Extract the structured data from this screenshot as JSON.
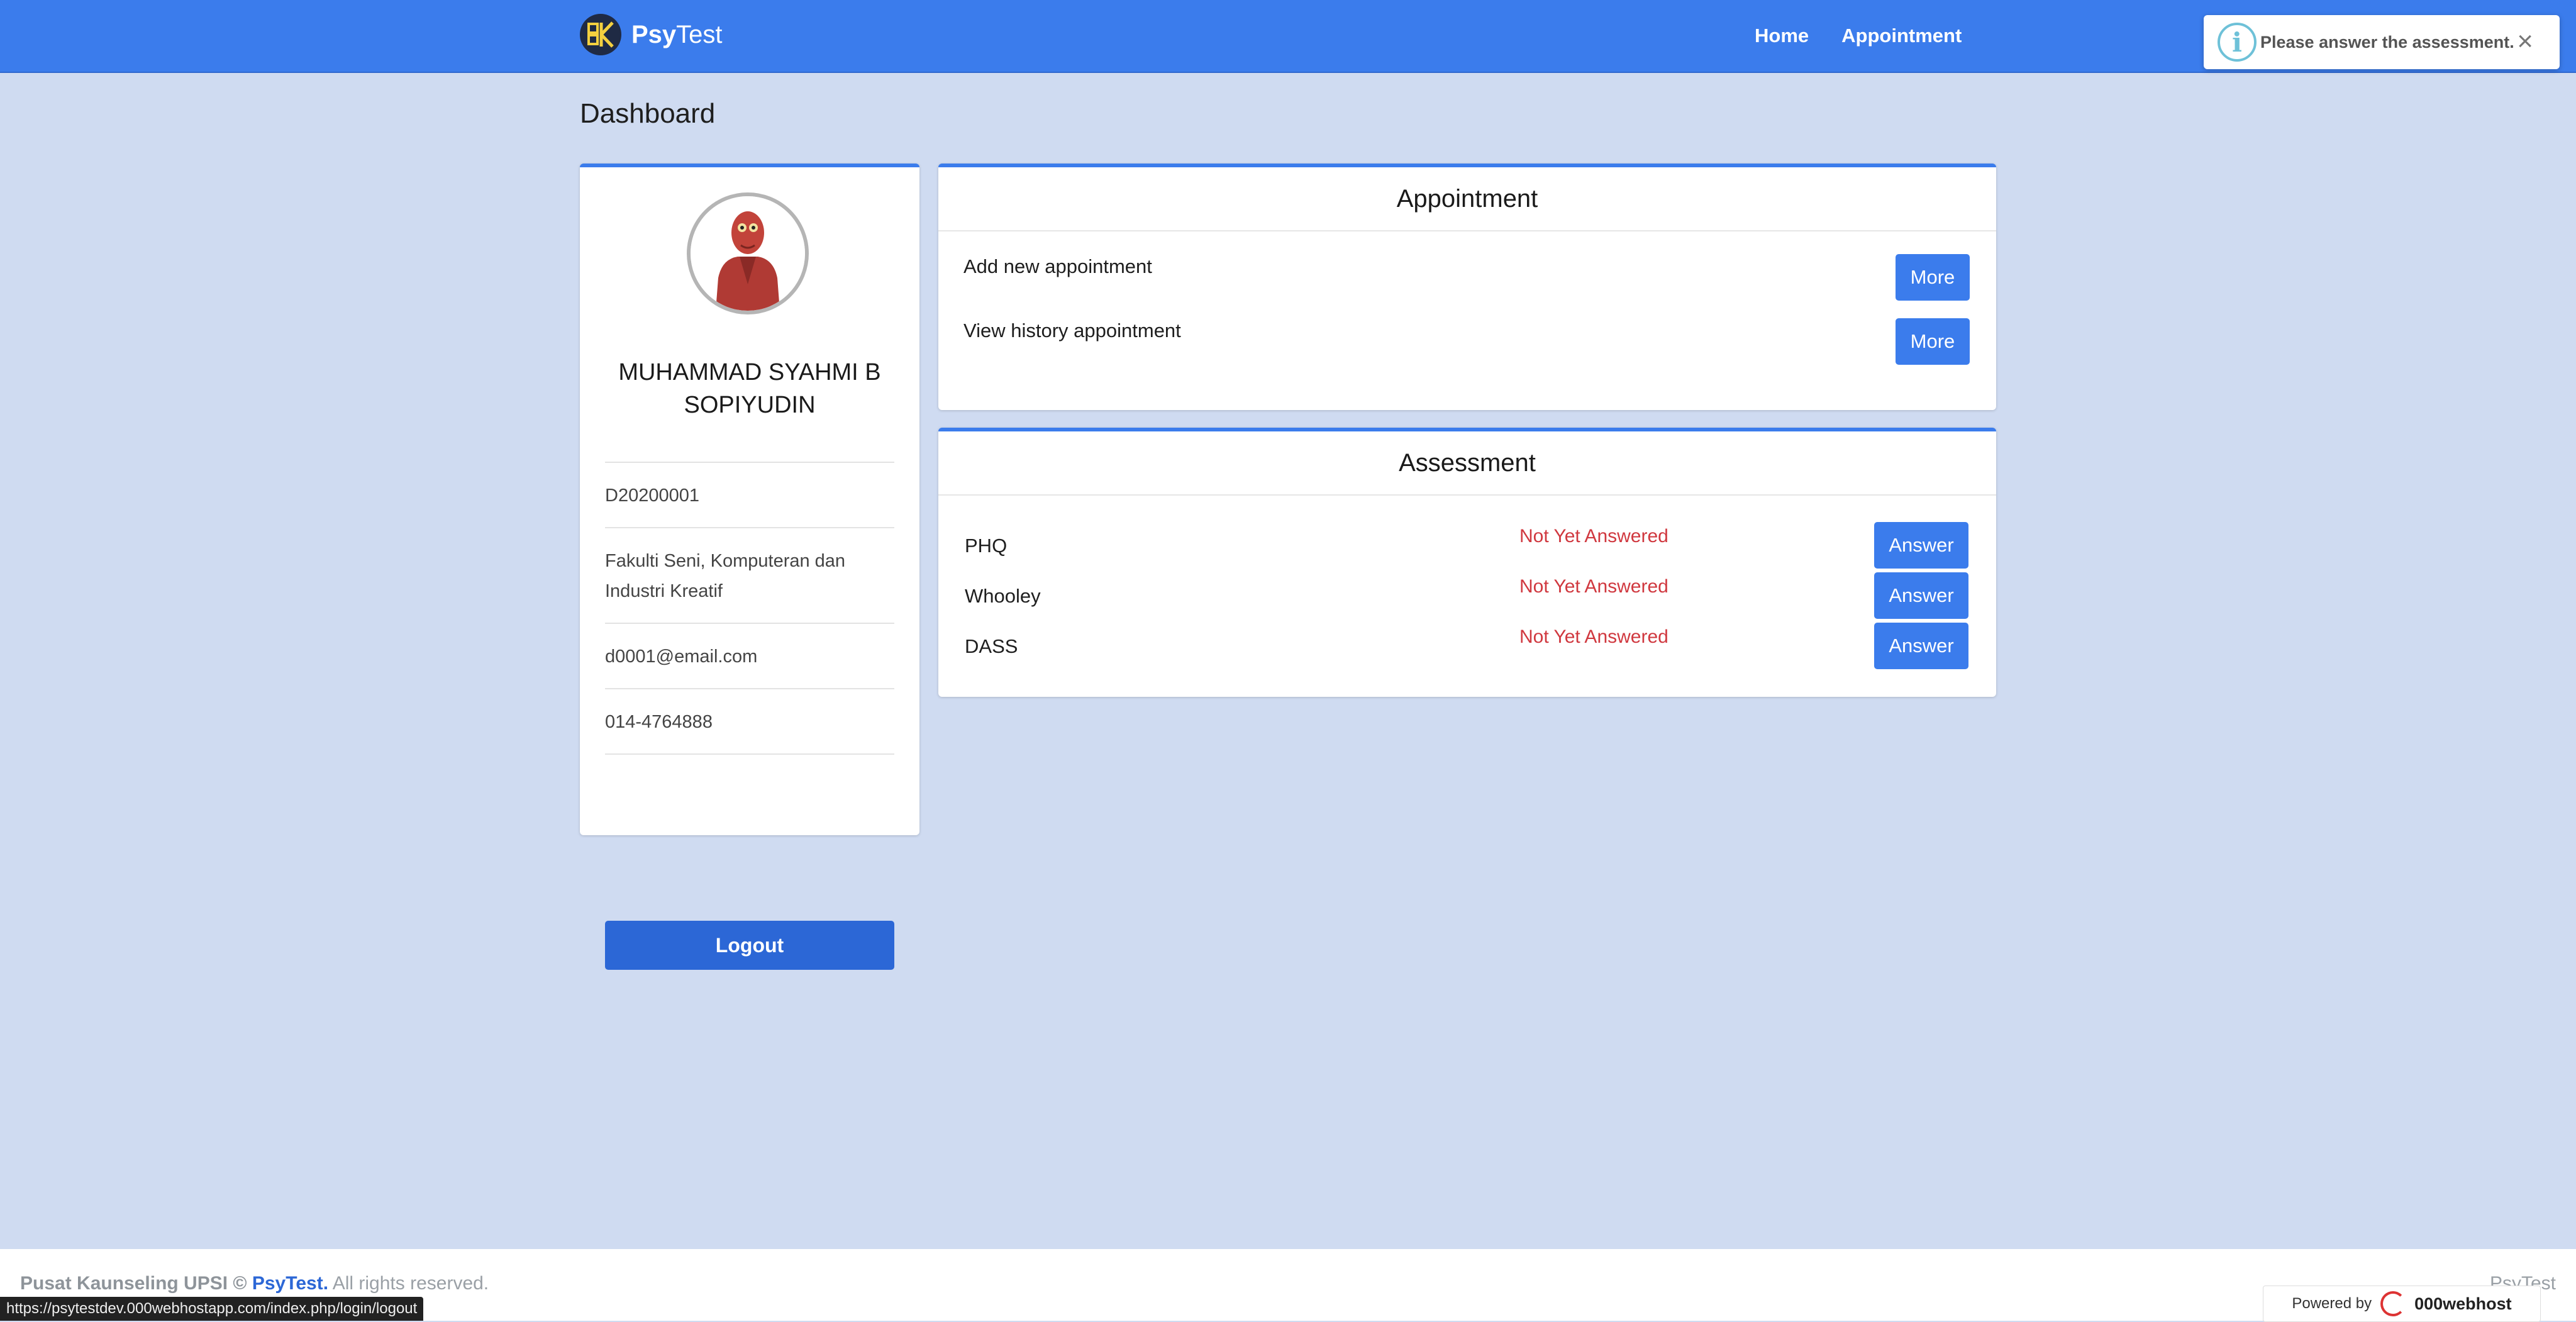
{
  "navbar": {
    "brand_bold": "Psy",
    "brand_regular": "Test",
    "links": [
      "Home",
      "Appointment"
    ]
  },
  "toast": {
    "icon": "info-icon",
    "message": "Please answer the assessment.",
    "close": "×"
  },
  "page": {
    "title": "Dashboard"
  },
  "profile": {
    "name": "MUHAMMAD SYAHMI B SOPIYUDIN",
    "id": "D20200001",
    "faculty": "Fakulti Seni, Komputeran dan Industri Kreatif",
    "email": "d0001@email.com",
    "phone": "014-4764888",
    "logout_label": "Logout"
  },
  "appointment": {
    "title": "Appointment",
    "items": [
      {
        "label": "Add new appointment",
        "button": "More"
      },
      {
        "label": "View history appointment",
        "button": "More"
      }
    ]
  },
  "assessment": {
    "title": "Assessment",
    "items": [
      {
        "name": "PHQ",
        "status": "Not Yet Answered",
        "button": "Answer"
      },
      {
        "name": "Whooley",
        "status": "Not Yet Answered",
        "button": "Answer"
      },
      {
        "name": "DASS",
        "status": "Not Yet Answered",
        "button": "Answer"
      }
    ]
  },
  "footer": {
    "org": "Pusat Kaunseling UPSI ©",
    "brand": "PsyTest.",
    "rights": "All rights reserved.",
    "right_text": "PsyTest"
  },
  "statusbar": {
    "url": "https://psytestdev.000webhostapp.com/index.php/login/logout"
  },
  "powered_by": {
    "label": "Powered by",
    "brand": "000webhost"
  },
  "colors": {
    "primary": "#3b7cec",
    "background": "#cfdbf1",
    "status_red": "#d0383f"
  }
}
